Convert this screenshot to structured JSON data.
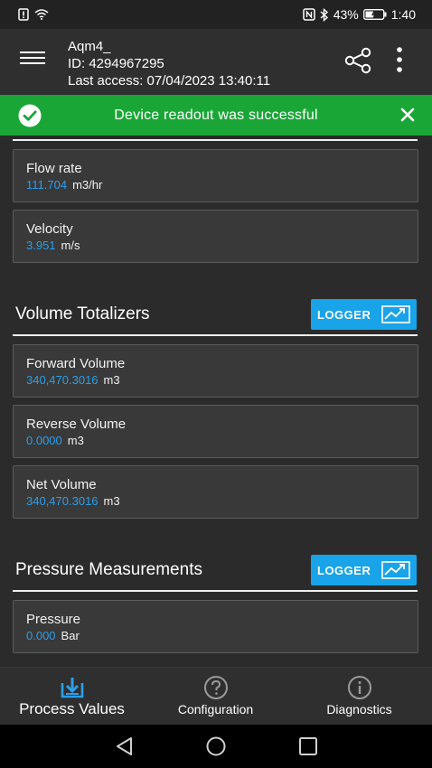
{
  "status_bar": {
    "battery": "43%",
    "time": "1:40"
  },
  "app_bar": {
    "device_name": "Aqm4_",
    "device_id": "ID: 4294967295",
    "last_access": "Last access: 07/04/2023 13:40:11"
  },
  "banner": {
    "message": "Device readout was successful",
    "color": "#1aa636"
  },
  "flow_cards": [
    {
      "title": "Flow rate",
      "value": "111.704",
      "unit": "m3/hr"
    },
    {
      "title": "Velocity",
      "value": "3.951",
      "unit": "m/s"
    }
  ],
  "volume_section": {
    "title": "Volume Totalizers",
    "logger_label": "LOGGER",
    "cards": [
      {
        "title": "Forward Volume",
        "value": "340,470.3016",
        "unit": "m3"
      },
      {
        "title": "Reverse Volume",
        "value": "0.0000",
        "unit": "m3"
      },
      {
        "title": "Net Volume",
        "value": "340,470.3016",
        "unit": "m3"
      }
    ]
  },
  "pressure_section": {
    "title": "Pressure Measurements",
    "logger_label": "LOGGER",
    "cards": [
      {
        "title": "Pressure",
        "value": "0.000",
        "unit": "Bar"
      }
    ]
  },
  "bottom_nav": [
    {
      "label": "Process Values",
      "icon": "download-icon",
      "active": true
    },
    {
      "label": "Configuration",
      "icon": "question-icon",
      "active": false
    },
    {
      "label": "Diagnostics",
      "icon": "info-icon",
      "active": false
    }
  ],
  "colors": {
    "accent": "#19a3e8",
    "value_text": "#2d9ee8",
    "background": "#2b2b2b",
    "card": "#393939"
  }
}
